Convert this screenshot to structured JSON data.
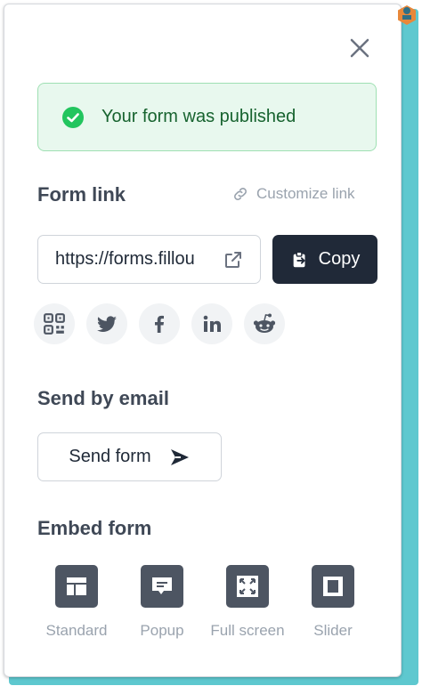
{
  "banner": {
    "message": "Your form was published"
  },
  "form_link": {
    "title": "Form link",
    "customize_label": "Customize link",
    "url_display": "https://forms.fillou",
    "copy_label": "Copy"
  },
  "social": [
    {
      "name": "qr-code-icon"
    },
    {
      "name": "twitter-icon"
    },
    {
      "name": "facebook-icon"
    },
    {
      "name": "linkedin-icon"
    },
    {
      "name": "reddit-icon"
    }
  ],
  "email": {
    "title": "Send by email",
    "send_label": "Send form"
  },
  "embed": {
    "title": "Embed form",
    "options": [
      {
        "label": "Standard",
        "icon": "layout-standard-icon"
      },
      {
        "label": "Popup",
        "icon": "popup-icon"
      },
      {
        "label": "Full screen",
        "icon": "full-screen-icon"
      },
      {
        "label": "Slider",
        "icon": "slider-icon"
      }
    ]
  },
  "colors": {
    "accent_dark": "#202938",
    "success_bg": "#e8f8ee",
    "success_text": "#17632f",
    "muted": "#9aa3ae",
    "frame": "#5ec8cf"
  }
}
